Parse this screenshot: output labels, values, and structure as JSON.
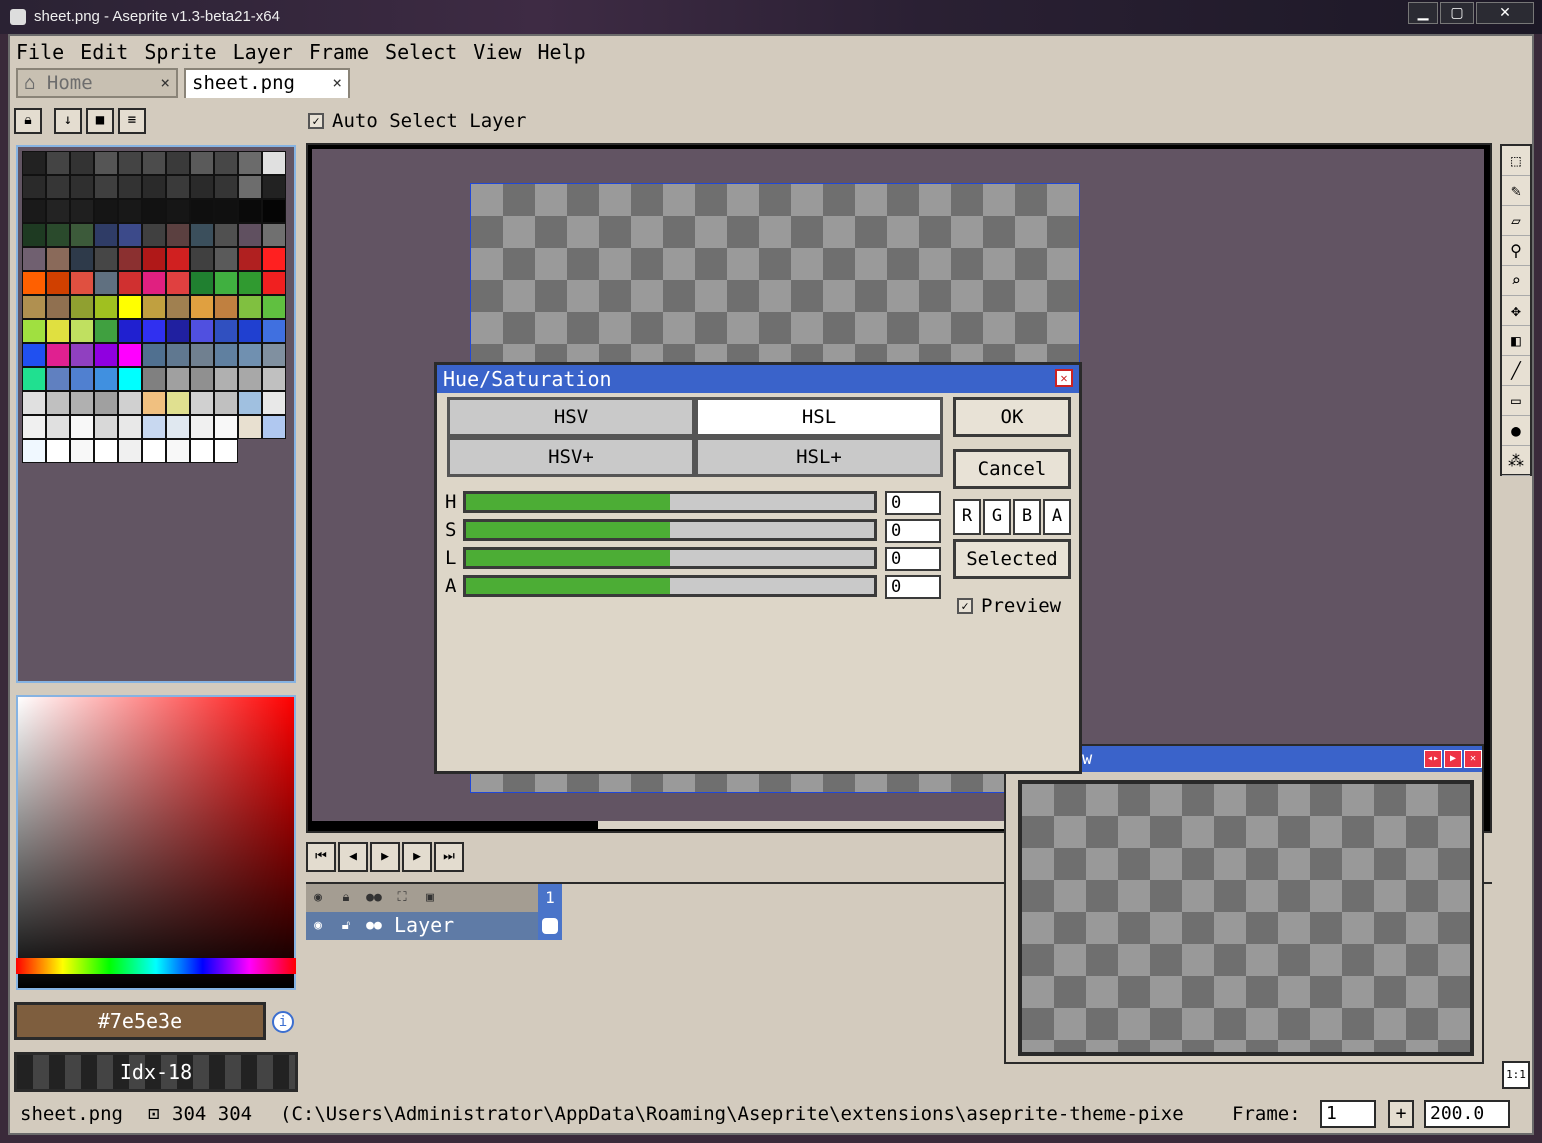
{
  "window": {
    "title": "sheet.png - Aseprite v1.3-beta21-x64",
    "min": "▁",
    "max": "▢",
    "close": "✕"
  },
  "menu": [
    "File",
    "Edit",
    "Sprite",
    "Layer",
    "Frame",
    "Select",
    "View",
    "Help"
  ],
  "tabs": [
    {
      "label": "Home",
      "icon": "home-icon",
      "close": "×"
    },
    {
      "label": "sheet.png",
      "close": "×"
    }
  ],
  "context_bar": {
    "auto_select_label": "Auto Select Layer",
    "auto_select_checked": true
  },
  "color": {
    "hex_label": "#7e5e3e",
    "index_label": "Idx-18",
    "fg": "#7e5e3e"
  },
  "palette_colors": [
    "#222222",
    "#444444",
    "#333333",
    "#555555",
    "#444444",
    "#4c4c4c",
    "#3a3a3a",
    "#5a5a5a",
    "#474747",
    "#6b6b6b",
    "#e0e0e0",
    "#2a2a2a",
    "#363636",
    "#2f2f2f",
    "#3f3f3f",
    "#333333",
    "#2a2a2a",
    "#3a3a3a",
    "#2a2a2a",
    "#353535",
    "#6d6d6d",
    "#222222",
    "#1a1a1a",
    "#232323",
    "#1f1f1f",
    "#151515",
    "#181818",
    "#121212",
    "#161616",
    "#0f0f0f",
    "#101010",
    "#0a0a0a",
    "#050505",
    "#1e3a22",
    "#2a4a2c",
    "#3c5a3a",
    "#2f3c66",
    "#3c4a8a",
    "#404040",
    "#5b4040",
    "#3b4f5c",
    "#505050",
    "#605060",
    "#707070",
    "#706070",
    "#8a6a5a",
    "#2e3a4a",
    "#464646",
    "#8b3030",
    "#b01818",
    "#d02020",
    "#404040",
    "#5a5a5a",
    "#b02020",
    "#ff2020",
    "#ff6000",
    "#d04000",
    "#e05040",
    "#607080",
    "#d03030",
    "#e02080",
    "#e04040",
    "#208030",
    "#40b040",
    "#309a30",
    "#f02020",
    "#b09050",
    "#907050",
    "#90a030",
    "#a0c020",
    "#ffff00",
    "#c0a040",
    "#a08050",
    "#e0a040",
    "#c08040",
    "#80c040",
    "#60c040",
    "#a0e040",
    "#e0e040",
    "#c0e060",
    "#40a040",
    "#2020d0",
    "#3030f0",
    "#2020a0",
    "#5050e0",
    "#3050c0",
    "#2040d0",
    "#4070e0",
    "#2050f0",
    "#e02090",
    "#9040c0",
    "#9000e0",
    "#ff00ff",
    "#507090",
    "#607890",
    "#708090",
    "#6080a0",
    "#7090b0",
    "#8090a0",
    "#20e090",
    "#6080c0",
    "#5080d0",
    "#4090e0",
    "#00ffff",
    "#808080",
    "#a0a0a0",
    "#909090",
    "#b0b0b0",
    "#a8a8a8",
    "#c0c0c0",
    "#e0e0e0",
    "#c0c0c0",
    "#b0b0b0",
    "#a0a0a0",
    "#d0d0d0",
    "#f0c080",
    "#e0e090",
    "#d0d0d0",
    "#c0c0c0",
    "#a0c0e0",
    "#e8e8e8",
    "#f0f0f0",
    "#e0e0e0",
    "#f8f8f8",
    "#d8d8d8",
    "#e8e8e8",
    "#c8d8f0",
    "#e0e8f0",
    "#f0f0f0",
    "#f8f8f8",
    "#e8e0d0",
    "#b0c8f0",
    "#f0f8ff",
    "#ffffff",
    "#f8f8f8",
    "#ffffff",
    "#f0f0f0",
    "#ffffff",
    "#f8f8f8",
    "#ffffff",
    "#ffffff"
  ],
  "animation": {
    "first": "⏮",
    "prev": "◀",
    "play": "▶",
    "next": "▶",
    "last": "⏭"
  },
  "timeline": {
    "frame_number": "1",
    "layer_name": "Layer"
  },
  "dialog": {
    "title": "Hue/Saturation",
    "close": "✕",
    "modes": [
      "HSV",
      "HSL",
      "HSV+",
      "HSL+"
    ],
    "selected_mode": "HSL",
    "ok": "OK",
    "cancel": "Cancel",
    "sliders": [
      {
        "label": "H",
        "value": "0",
        "percent": 50
      },
      {
        "label": "S",
        "value": "0",
        "percent": 50
      },
      {
        "label": "L",
        "value": "0",
        "percent": 50
      },
      {
        "label": "A",
        "value": "0",
        "percent": 50
      }
    ],
    "channels": [
      "R",
      "G",
      "B",
      "A"
    ],
    "selected_label": "Selected",
    "preview_label": "Preview",
    "preview_checked": true
  },
  "preview_window": {
    "title_fragment": "w"
  },
  "status": {
    "filename": "sheet.png",
    "size_icon": "image-size-icon",
    "size": "304 304",
    "path": "(C:\\Users\\Administrator\\AppData\\Roaming\\Aseprite\\extensions\\aseprite-theme-pixe",
    "frame_label": "Frame:",
    "frame_value": "1",
    "add_frame": "+",
    "zoom": "200.0"
  },
  "toolbar_icons": [
    "marquee-icon",
    "pencil-icon",
    "eraser-icon",
    "eyedropper-icon",
    "zoom-icon",
    "move-icon",
    "paint-bucket-icon",
    "line-icon",
    "rectangle-icon",
    "blur-icon",
    "spray-icon"
  ],
  "one_to_one": "1:1"
}
